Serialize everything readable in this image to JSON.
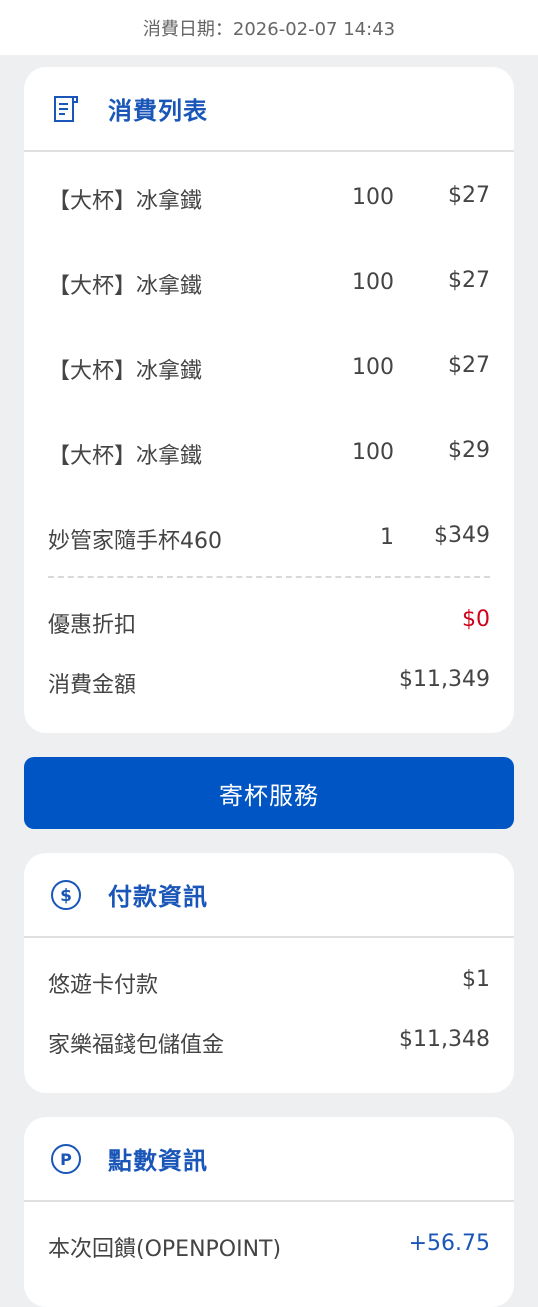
{
  "header": {
    "date_text": "消費日期：2026-02-07 14:43"
  },
  "consumption": {
    "title": "消費列表",
    "items": [
      {
        "name": "【大杯】冰拿鐵",
        "qty": "100",
        "price": "$27"
      },
      {
        "name": "【大杯】冰拿鐵",
        "qty": "100",
        "price": "$27"
      },
      {
        "name": "【大杯】冰拿鐵",
        "qty": "100",
        "price": "$27"
      },
      {
        "name": "【大杯】冰拿鐵",
        "qty": "100",
        "price": "$29"
      },
      {
        "name": "妙管家隨手杯460",
        "qty": "1",
        "price": "$349"
      }
    ],
    "discount_label": "優惠折扣",
    "discount_value": "$0",
    "total_label": "消費金額",
    "total_value": "$11,349"
  },
  "cup_service_button": "寄杯服務",
  "payment": {
    "title": "付款資訊",
    "rows": [
      {
        "label": "悠遊卡付款",
        "value": "$1"
      },
      {
        "label": "家樂福錢包儲值金",
        "value": "$11,348"
      }
    ]
  },
  "points": {
    "title": "點數資訊",
    "rows": [
      {
        "label": "本次回饋(OPENPOINT)",
        "value": "+56.75"
      }
    ]
  },
  "colors": {
    "accent": "#1a56b8",
    "button": "#0055c4",
    "discount": "#d0021b"
  },
  "icons": {
    "consumption": "receipt-icon",
    "payment": "dollar-icon",
    "points": "points-icon"
  }
}
